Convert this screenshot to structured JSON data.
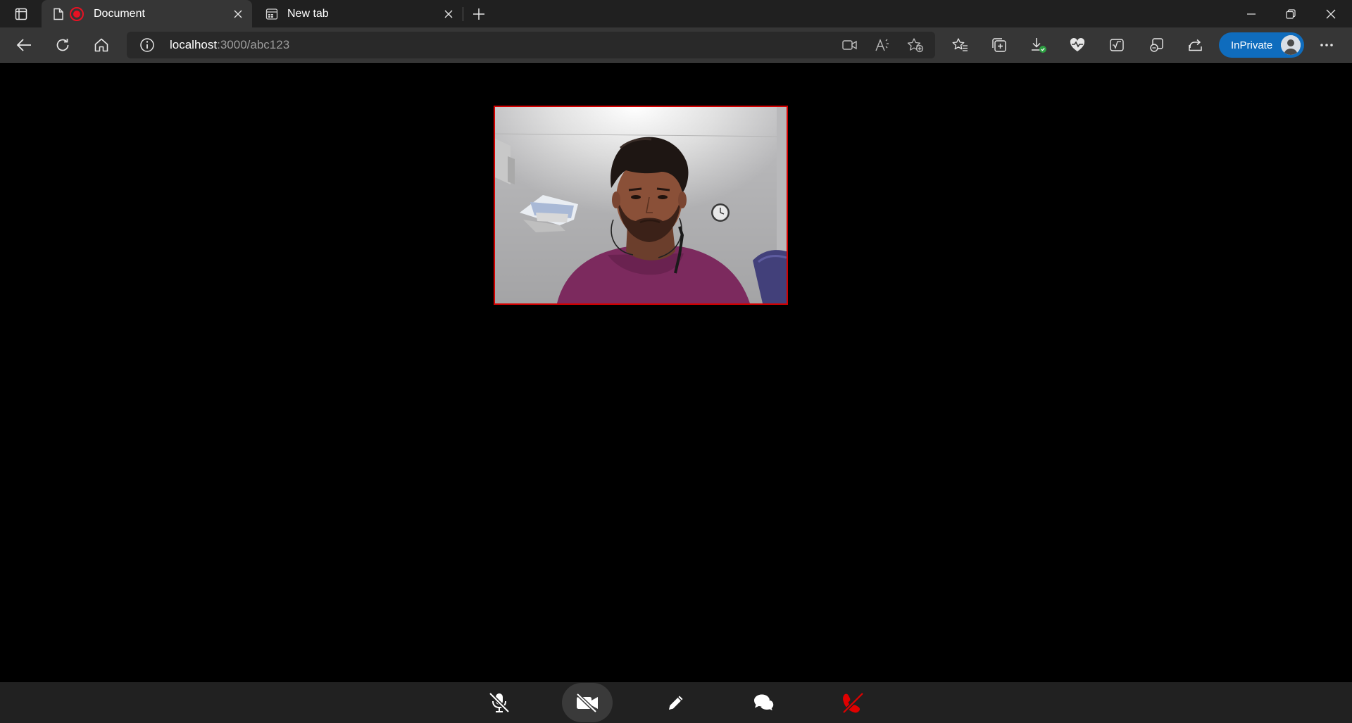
{
  "browser": {
    "tabs": [
      {
        "title": "Document",
        "active": true,
        "recording": true
      },
      {
        "title": "New tab",
        "active": false
      }
    ],
    "address": {
      "host": "localhost",
      "path": ":3000/abc123"
    },
    "inprivate_label": "InPrivate",
    "accent_color": "#0f6cbd"
  },
  "video": {
    "tile_border_color": "#d40000",
    "content": "webcam-feed"
  },
  "controls": {
    "buttons": [
      {
        "name": "mute-mic",
        "icon": "microphone-slash-icon"
      },
      {
        "name": "stop-video",
        "icon": "video-slash-icon",
        "highlighted": true
      },
      {
        "name": "whiteboard",
        "icon": "pencil-icon"
      },
      {
        "name": "chat",
        "icon": "chat-bubbles-icon"
      },
      {
        "name": "hang-up",
        "icon": "phone-hangup-icon",
        "color": "#e00000"
      }
    ]
  }
}
